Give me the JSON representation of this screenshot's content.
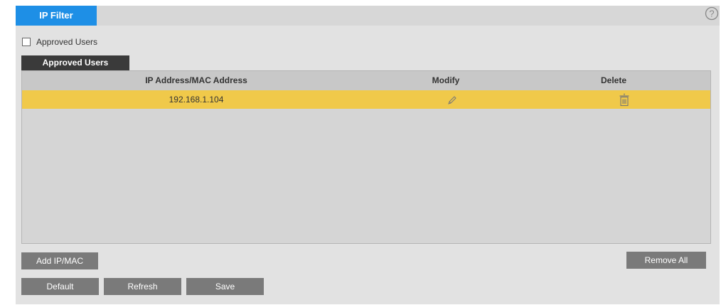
{
  "tabs": {
    "active_label": "IP Filter"
  },
  "help": {
    "icon": "question-circle-icon"
  },
  "approved_users_checkbox": {
    "label": "Approved Users",
    "checked": false
  },
  "subtab": {
    "label": "Approved Users"
  },
  "table": {
    "headers": [
      "IP Address/MAC Address",
      "Modify",
      "Delete"
    ],
    "rows": [
      {
        "address": "192.168.1.104",
        "modify_icon": "pencil-icon",
        "delete_icon": "trash-icon",
        "highlighted": true
      }
    ]
  },
  "buttons": {
    "add": "Add IP/MAC",
    "remove_all": "Remove All",
    "default": "Default",
    "refresh": "Refresh",
    "save": "Save"
  },
  "colors": {
    "tab_active": "#1e8fe6",
    "row_highlight": "#f0c94a",
    "button": "#7a7a7a",
    "subtab": "#3a3a3a"
  }
}
